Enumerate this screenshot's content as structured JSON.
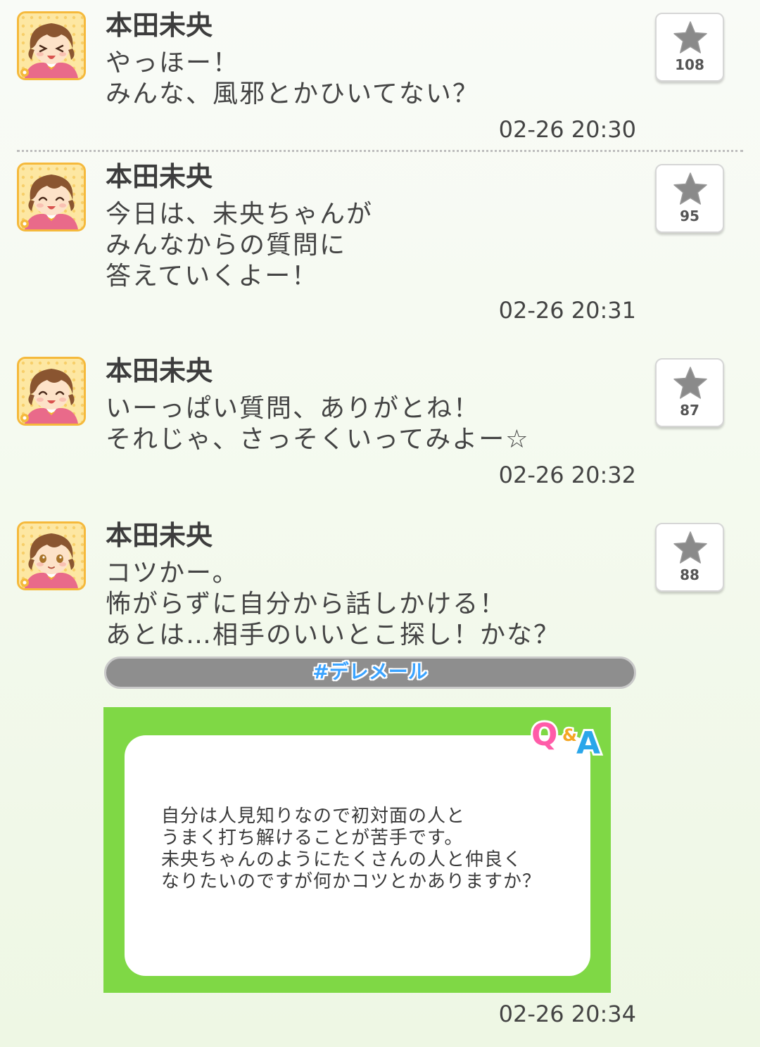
{
  "posts": [
    {
      "name": "本田未央",
      "lines": [
        "やっほー！",
        "みんな、風邪とかひいてない？"
      ],
      "time": "02-26 20:30",
      "likes": "108",
      "expression": "laughing"
    },
    {
      "name": "本田未央",
      "lines": [
        "今日は、未央ちゃんが",
        "みんなからの質問に",
        "答えていくよー！"
      ],
      "time": "02-26 20:31",
      "likes": "95",
      "expression": "smiling"
    },
    {
      "name": "本田未央",
      "lines": [
        "いーっぱい質問、ありがとね！",
        "それじゃ、さっそくいってみよー☆"
      ],
      "time": "02-26 20:32",
      "likes": "87",
      "expression": "smiling"
    },
    {
      "name": "本田未央",
      "lines": [
        "コツかー。",
        "怖がらずに自分から話しかける！",
        "あとは…相手のいいとこ探し！かな？"
      ],
      "time": "02-26 20:34",
      "likes": "88",
      "expression": "neutral",
      "hashtag": "#デレメール",
      "qa": {
        "logo": "Q&A",
        "lines": [
          "自分は人見知りなので初対面の人と",
          "うまく打ち解けることが苦手です。",
          "未央ちゃんのようにたくさんの人と仲良く",
          "なりたいのですが何かコツとかありますか？"
        ]
      }
    }
  ],
  "colors": {
    "qa_frame": "#7fd845",
    "hashtag_text": "#3aa3ff",
    "avatar_border": "#f5b93c",
    "star": "#8a8a8a"
  },
  "icons": {
    "like": "star-icon",
    "avatar": "character-avatar",
    "qa": "qa-logo-icon"
  }
}
